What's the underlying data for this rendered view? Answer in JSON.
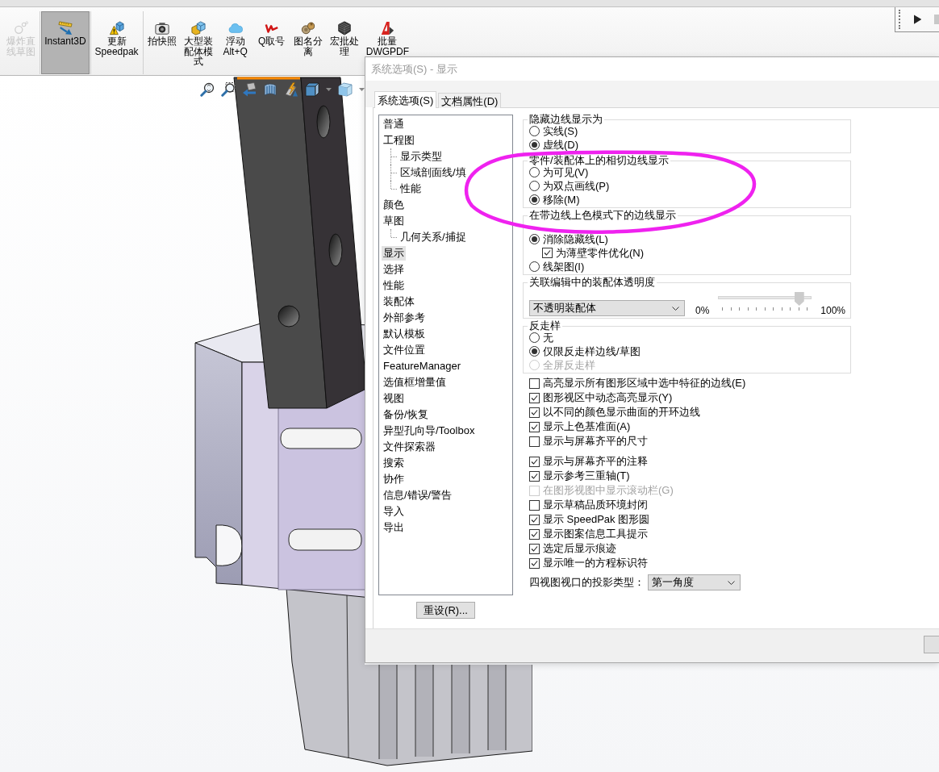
{
  "command_manager": {
    "groups": [
      {
        "buttons": [
          {
            "label": "爆炸直线草图",
            "selected": false,
            "disabled": true
          }
        ]
      },
      {
        "buttons": [
          {
            "label": "Instant3D",
            "selected": true,
            "disabled": false
          }
        ]
      },
      {
        "buttons": [
          {
            "label": "更新 Speedpak",
            "selected": false,
            "disabled": false
          }
        ]
      },
      {
        "buttons": [
          {
            "label": "拍快照",
            "selected": false,
            "disabled": false
          },
          {
            "label": "大型装配体模式",
            "selected": false,
            "disabled": false
          },
          {
            "label": "浮动 Alt+Q",
            "selected": false,
            "disabled": false
          },
          {
            "label": "Q取号",
            "selected": false,
            "disabled": false
          },
          {
            "label": "图名分离",
            "selected": false,
            "disabled": false
          },
          {
            "label": "宏批处理",
            "selected": false,
            "disabled": false
          },
          {
            "label": "批量 DWGPDF",
            "selected": false,
            "disabled": false
          }
        ]
      }
    ]
  },
  "dialog": {
    "title": "系统选项(S) - 显示",
    "tabs": [
      {
        "label": "系统选项(S)",
        "selected": true
      },
      {
        "label": "文档属性(D)",
        "selected": false
      }
    ],
    "tree": [
      {
        "label": "普通",
        "selected": false
      },
      {
        "label": "工程图",
        "selected": false,
        "children": [
          {
            "label": "显示类型",
            "selected": false
          },
          {
            "label": "区域剖面线/填",
            "selected": false
          },
          {
            "label": "性能",
            "selected": false
          }
        ]
      },
      {
        "label": "颜色",
        "selected": false
      },
      {
        "label": "草图",
        "selected": false,
        "children": [
          {
            "label": "几何关系/捕捉",
            "selected": false
          }
        ]
      },
      {
        "label": "显示",
        "selected": true
      },
      {
        "label": "选择",
        "selected": false
      },
      {
        "label": "性能",
        "selected": false
      },
      {
        "label": "装配体",
        "selected": false
      },
      {
        "label": "外部参考",
        "selected": false
      },
      {
        "label": "默认模板",
        "selected": false
      },
      {
        "label": "文件位置",
        "selected": false
      },
      {
        "label": "FeatureManager",
        "selected": false
      },
      {
        "label": "选值框增量值",
        "selected": false
      },
      {
        "label": "视图",
        "selected": false
      },
      {
        "label": "备份/恢复",
        "selected": false
      },
      {
        "label": "异型孔向导/Toolbox",
        "selected": false
      },
      {
        "label": "文件探索器",
        "selected": false
      },
      {
        "label": "搜索",
        "selected": false
      },
      {
        "label": "协作",
        "selected": false
      },
      {
        "label": "信息/错误/警告",
        "selected": false
      },
      {
        "label": "导入",
        "selected": false
      },
      {
        "label": "导出",
        "selected": false
      }
    ],
    "reset_button": "重设(R)...",
    "groups": [
      {
        "title": "隐藏边线显示为",
        "kind": "stack",
        "items": [
          {
            "kind": "radio",
            "label": "实线(S)",
            "selected": false,
            "disabled": false
          },
          {
            "kind": "radio",
            "label": "虚线(D)",
            "selected": true,
            "disabled": false
          }
        ]
      },
      {
        "title": "零件/装配体上的相切边线显示",
        "kind": "stack",
        "items": [
          {
            "kind": "radio",
            "label": "为可见(V)",
            "selected": false,
            "disabled": false
          },
          {
            "kind": "radio",
            "label": "为双点画线(P)",
            "selected": false,
            "disabled": false
          },
          {
            "kind": "radio",
            "label": "移除(M)",
            "selected": true,
            "disabled": false
          }
        ]
      },
      {
        "title": "在带边线上色模式下的边线显示",
        "kind": "stack",
        "items": [
          {
            "kind": "radio",
            "label": "消除隐藏线(L)",
            "selected": true,
            "disabled": false,
            "children": [
              {
                "kind": "checkbox",
                "label": "为薄壁零件优化(N)",
                "checked": true,
                "disabled": false
              }
            ]
          },
          {
            "kind": "radio",
            "label": "线架图(I)",
            "selected": false,
            "disabled": false
          }
        ]
      },
      {
        "title": "关联编辑中的装配体透明度",
        "kind": "row",
        "items": [
          {
            "kind": "dropdown",
            "value": "不透明装配体"
          },
          {
            "kind": "slider",
            "min_label": "0%",
            "max_label": "100%",
            "level": 0.9
          }
        ]
      },
      {
        "title": "反走样",
        "kind": "stack",
        "items": [
          {
            "kind": "radio",
            "label": "无",
            "selected": false,
            "disabled": false
          },
          {
            "kind": "radio",
            "label": "仅限反走样边线/草图",
            "selected": true,
            "disabled": false
          },
          {
            "kind": "radio",
            "label": "全屏反走样",
            "selected": false,
            "disabled": true
          }
        ]
      }
    ],
    "checkbox_groups": [
      {
        "items": [
          {
            "label": "高亮显示所有图形区域中选中特征的边线(E)",
            "checked": false,
            "disabled": false
          },
          {
            "label": "图形视区中动态高亮显示(Y)",
            "checked": true,
            "disabled": false
          },
          {
            "label": "以不同的颜色显示曲面的开环边线",
            "checked": true,
            "disabled": false
          },
          {
            "label": "显示上色基准面(A)",
            "checked": true,
            "disabled": false
          },
          {
            "label": "显示与屏幕齐平的尺寸",
            "checked": false,
            "disabled": false
          }
        ]
      },
      {
        "items": [
          {
            "label": "显示与屏幕齐平的注释",
            "checked": true,
            "disabled": false
          },
          {
            "label": "显示参考三重轴(T)",
            "checked": true,
            "disabled": false
          },
          {
            "label": "在图形视图中显示滚动栏(G)",
            "checked": false,
            "disabled": true
          },
          {
            "label": "显示草稿品质环境封闭",
            "checked": false,
            "disabled": false
          },
          {
            "label": "显示 SpeedPak 图形圆",
            "checked": true,
            "disabled": false
          },
          {
            "label": "显示图案信息工具提示",
            "checked": true,
            "disabled": false
          },
          {
            "label": "选定后显示痕迹",
            "checked": true,
            "disabled": false
          },
          {
            "label": "显示唯一的方程标识符",
            "checked": true,
            "disabled": false
          }
        ]
      }
    ],
    "projection": {
      "label": "四视图视口的投影类型：",
      "value": "第一角度"
    }
  },
  "annotations": [
    {
      "kind": "ellipse"
    }
  ]
}
